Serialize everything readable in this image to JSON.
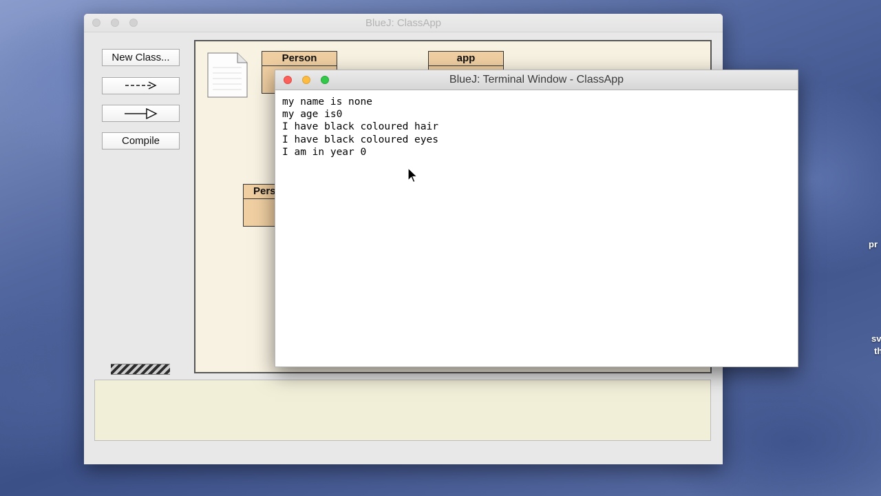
{
  "main_window": {
    "title": "BlueJ:  ClassApp",
    "toolbar": {
      "new_class_label": "New Class...",
      "dependency_arrow_label": "--->",
      "inheritance_arrow_label": "—▷",
      "compile_label": "Compile"
    },
    "classes": [
      {
        "name": "Person"
      },
      {
        "name": "app"
      },
      {
        "name": "Pers"
      }
    ],
    "message_area": ""
  },
  "terminal": {
    "title": "BlueJ: Terminal Window - ClassApp",
    "lines": [
      "my name is none",
      "my age is0",
      "I have black coloured hair",
      "I have black coloured eyes",
      "I am in year 0"
    ]
  },
  "desktop_fragments": [
    "pr",
    "sv",
    "th"
  ],
  "colors": {
    "class_fill": "#f0cfa2",
    "canvas_bg": "#f8f2e2",
    "close": "#fc605b",
    "minimize": "#fdbc40",
    "zoom": "#34c84a"
  }
}
